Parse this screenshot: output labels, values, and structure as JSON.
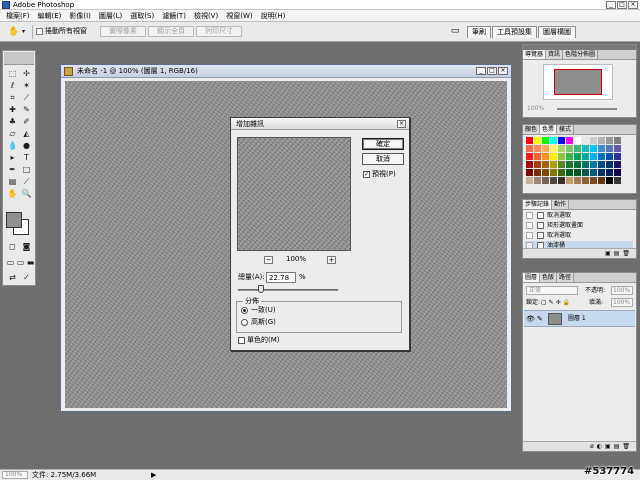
{
  "app": {
    "title": "Adobe Photoshop"
  },
  "window_buttons": {
    "minimize": "_",
    "maximize": "□",
    "close": "×"
  },
  "menu": [
    "檔案(F)",
    "編輯(E)",
    "影像(I)",
    "圖層(L)",
    "選取(S)",
    "濾鏡(T)",
    "檢視(V)",
    "視窗(W)",
    "說明(H)"
  ],
  "options": {
    "scroll_all_label": "捲動所有視窗",
    "actual_pixels": "實際像素",
    "fit_screen": "顯示全頁",
    "print_size": "列印尺寸"
  },
  "palette_well_tabs": [
    "筆刷",
    "工具預設集",
    "圖層構圖"
  ],
  "document": {
    "title": "未命名 -1 @ 100% (圖層 1, RGB/16)"
  },
  "dialog": {
    "title": "增加雜訊",
    "ok": "確定",
    "cancel": "取消",
    "preview_label": "預視(P)",
    "zoom_minus": "−",
    "zoom_plus": "+",
    "zoom_percent": "100%",
    "amount_label": "總量(A):",
    "amount_value": "22.78",
    "amount_unit": "%",
    "amount_fraction": 0.2278,
    "distribution_label": "分佈",
    "uniform_label": "一致(U)",
    "gaussian_label": "高斯(G)",
    "monochromatic_label": "單色的(M)"
  },
  "navigator": {
    "tabs": [
      "導覽器",
      "資訊",
      "色階分佈圖"
    ],
    "zoom": "100%"
  },
  "color_palette": {
    "tabs": [
      "顏色",
      "色票",
      "樣式"
    ]
  },
  "history": {
    "tabs": [
      "步驟記錄",
      "動作"
    ],
    "items": [
      "取消選取",
      "矩形選取畫面",
      "取消選取",
      "油漆桶"
    ]
  },
  "layers": {
    "tabs": [
      "圖層",
      "色版",
      "路徑"
    ],
    "blend_mode": "正常",
    "opacity_label": "不透明:",
    "opacity_value": "100%",
    "lock_label": "鎖定:",
    "fill_label": "填滿:",
    "fill_value": "100%",
    "layer_name": "圖層 1"
  },
  "status": {
    "zoom": "100%",
    "doc_info": "文件: 2.75M/3.66M",
    "arrow": "▶"
  },
  "watermark": "#537774",
  "colors": {
    "workspace": "#6e6e6e",
    "canvas_noise": "#8d8d8d",
    "selection": "#c8d8ee"
  }
}
